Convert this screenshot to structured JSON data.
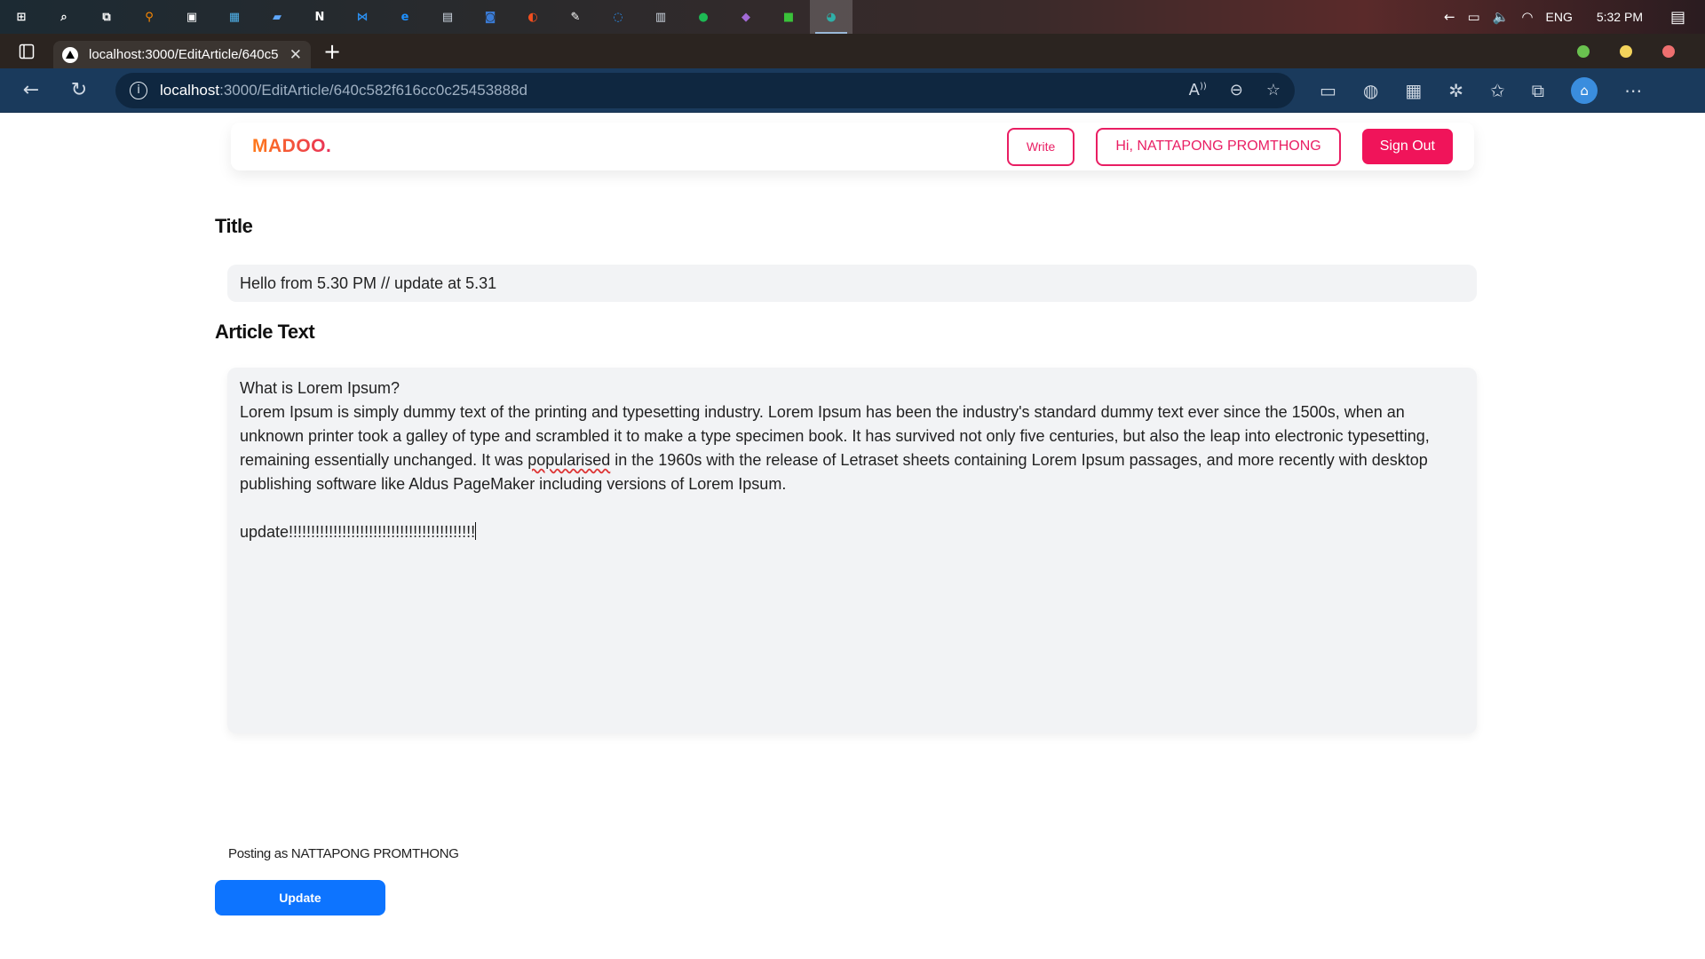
{
  "taskbar": {
    "apps": [
      {
        "name": "start-icon",
        "glyph": "⊞",
        "color": "#ffffff"
      },
      {
        "name": "search-icon",
        "glyph": "⌕",
        "color": "#ffffff"
      },
      {
        "name": "task-view-icon",
        "glyph": "⧉",
        "color": "#ffffff"
      },
      {
        "name": "search-app-icon",
        "glyph": "⚲",
        "color": "#ff8a00"
      },
      {
        "name": "terminal-icon",
        "glyph": "▣",
        "color": "#ffffff"
      },
      {
        "name": "calculator-icon",
        "glyph": "▦",
        "color": "#4fb0e8"
      },
      {
        "name": "folder-icon",
        "glyph": "▰",
        "color": "#5fa8ff"
      },
      {
        "name": "notion-icon",
        "glyph": "N",
        "color": "#ffffff"
      },
      {
        "name": "vscode-icon",
        "glyph": "⋈",
        "color": "#2b8ff0"
      },
      {
        "name": "edge-legacy-icon",
        "glyph": "e",
        "color": "#1e90ff"
      },
      {
        "name": "terminal2-icon",
        "glyph": "▤",
        "color": "#cfd8e3"
      },
      {
        "name": "gamepad-icon",
        "glyph": "◙",
        "color": "#3a7bd5"
      },
      {
        "name": "figma-icon",
        "glyph": "◐",
        "color": "#f24e1e"
      },
      {
        "name": "editor-icon",
        "glyph": "✎",
        "color": "#ffffff"
      },
      {
        "name": "browser2-icon",
        "glyph": "◌",
        "color": "#2b8ff0"
      },
      {
        "name": "files-icon",
        "glyph": "▥",
        "color": "#cfd8e3"
      },
      {
        "name": "spotify-icon",
        "glyph": "●",
        "color": "#1db954"
      },
      {
        "name": "visual-studio-icon",
        "glyph": "◆",
        "color": "#a26ad6"
      },
      {
        "name": "line-icon",
        "glyph": "■",
        "color": "#3ac23a"
      },
      {
        "name": "edge-icon",
        "glyph": "◕",
        "color": "#2fb0a8"
      }
    ],
    "tray": {
      "language": "ENG",
      "time": "5:32 PM"
    }
  },
  "browser": {
    "tab_title": "localhost:3000/EditArticle/640c5",
    "url_host": "localhost",
    "url_path": ":3000/EditArticle/640c582f616cc0c25453888d",
    "window_dot_colors": [
      "#6ac14f",
      "#f3d35b",
      "#ee6f6f"
    ]
  },
  "header": {
    "logo": "MADOO.",
    "write_label": "Write",
    "greeting": "Hi, NATTAPONG PROMTHONG",
    "signout_label": "Sign Out"
  },
  "form": {
    "title_label": "Title",
    "title_value": "Hello from 5.30 PM // update at 5.31",
    "text_label": "Article Text",
    "text_heading": "What is Lorem Ipsum?",
    "text_body_1": "Lorem Ipsum is simply dummy text of the printing and typesetting industry. Lorem Ipsum has been the industry's standard dummy text ever since the 1500s, when an unknown printer took a galley of type and scrambled it to make a type specimen book. It has survived not only five centuries, but also the leap into electronic typesetting, remaining essentially unchanged. It was ",
    "text_spell_word": "popularised",
    "text_body_2": " in the 1960s with the release of Letraset sheets containing Lorem Ipsum passages, and more recently with desktop publishing software like Aldus PageMaker including versions of Lorem Ipsum.",
    "text_update_line": "update!!!!!!!!!!!!!!!!!!!!!!!!!!!!!!!!!!!!!!!!!!",
    "posting_as": "Posting as NATTAPONG PROMTHONG",
    "update_label": "Update"
  }
}
